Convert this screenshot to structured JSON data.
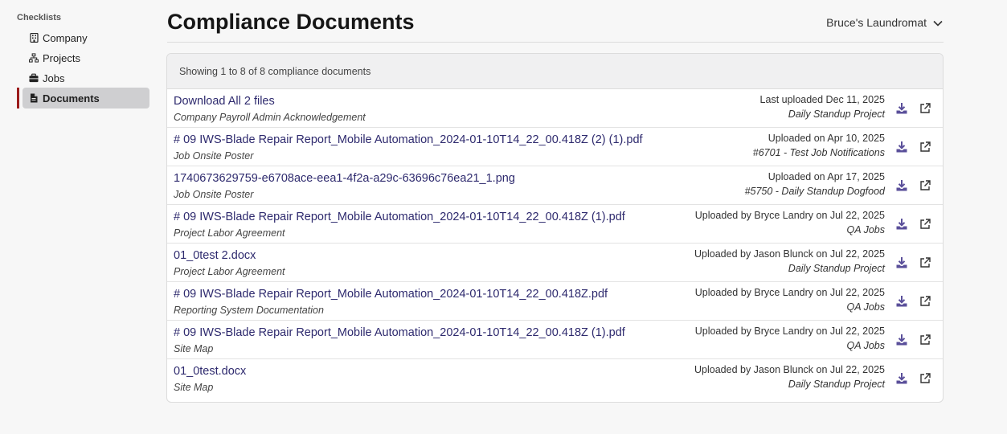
{
  "sidebar": {
    "heading": "Checklists",
    "items": [
      {
        "label": "Company",
        "icon": "building-icon"
      },
      {
        "label": "Projects",
        "icon": "sitemap-icon"
      },
      {
        "label": "Jobs",
        "icon": "briefcase-icon"
      },
      {
        "label": "Documents",
        "icon": "file-icon"
      }
    ]
  },
  "header": {
    "title": "Compliance Documents",
    "company": "Bruce's Laundromat"
  },
  "panel": {
    "summary": "Showing 1 to 8 of 8 compliance documents"
  },
  "rows": [
    {
      "title": "Download All 2 files",
      "subtitle": "Company Payroll Admin Acknowledgement",
      "meta1": "Last uploaded Dec 11, 2025",
      "meta2": "Daily Standup Project"
    },
    {
      "title": "# 09 IWS-Blade Repair Report_Mobile Automation_2024-01-10T14_22_00.418Z (2) (1).pdf",
      "subtitle": "Job Onsite Poster",
      "meta1": "Uploaded on Apr 10, 2025",
      "meta2": "#6701 - Test Job Notifications"
    },
    {
      "title": "1740673629759-e6708ace-eea1-4f2a-a29c-63696c76ea21_1.png",
      "subtitle": "Job Onsite Poster",
      "meta1": "Uploaded on Apr 17, 2025",
      "meta2": "#5750 - Daily Standup Dogfood"
    },
    {
      "title": "# 09 IWS-Blade Repair Report_Mobile Automation_2024-01-10T14_22_00.418Z (1).pdf",
      "subtitle": "Project Labor Agreement",
      "meta1": "Uploaded by Bryce Landry on Jul 22, 2025",
      "meta2": "QA Jobs"
    },
    {
      "title": "01_0test 2.docx",
      "subtitle": "Project Labor Agreement",
      "meta1": "Uploaded by Jason Blunck on Jul 22, 2025",
      "meta2": "Daily Standup Project"
    },
    {
      "title": "# 09 IWS-Blade Repair Report_Mobile Automation_2024-01-10T14_22_00.418Z.pdf",
      "subtitle": "Reporting System Documentation",
      "meta1": "Uploaded by Bryce Landry on Jul 22, 2025",
      "meta2": "QA Jobs"
    },
    {
      "title": "# 09 IWS-Blade Repair Report_Mobile Automation_2024-01-10T14_22_00.418Z (1).pdf",
      "subtitle": "Site Map",
      "meta1": "Uploaded by Bryce Landry on Jul 22, 2025",
      "meta2": "QA Jobs"
    },
    {
      "title": "01_0test.docx",
      "subtitle": "Site Map",
      "meta1": "Uploaded by Jason Blunck on Jul 22, 2025",
      "meta2": "Daily Standup Project"
    }
  ],
  "colors": {
    "accent": "#9b1c1c",
    "link": "#2e2a6e",
    "icon": "#5a4f9a"
  }
}
